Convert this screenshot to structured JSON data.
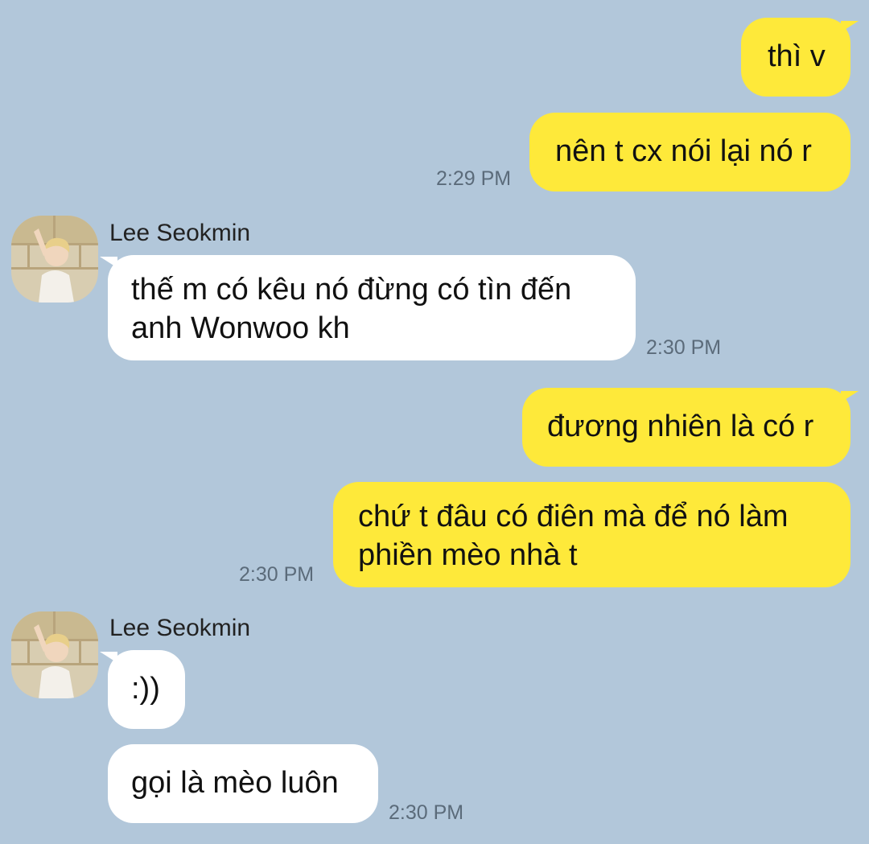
{
  "colors": {
    "background": "#b2c7da",
    "outgoing_bubble": "#fee93a",
    "incoming_bubble": "#ffffff",
    "timestamp": "#5b6b7a"
  },
  "messages": [
    {
      "direction": "outgoing",
      "text": "thì v"
    },
    {
      "direction": "outgoing",
      "text": "nên t cx nói lại nó r",
      "time": "2:29 PM"
    },
    {
      "direction": "incoming",
      "sender": "Lee Seokmin",
      "avatar": "avatar-photo",
      "lines": [
        "thế m có kêu nó đừng có tìn đến",
        "anh Wonwoo kh"
      ],
      "time": "2:30 PM"
    },
    {
      "direction": "outgoing",
      "text": "đương nhiên là có r"
    },
    {
      "direction": "outgoing",
      "lines": [
        "chứ t đâu có điên mà để nó làm",
        "phiền mèo nhà t"
      ],
      "time": "2:30 PM"
    },
    {
      "direction": "incoming",
      "sender": "Lee Seokmin",
      "avatar": "avatar-photo",
      "text": ":))"
    },
    {
      "direction": "incoming",
      "text": "gọi là mèo luôn",
      "time": "2:30 PM"
    }
  ]
}
